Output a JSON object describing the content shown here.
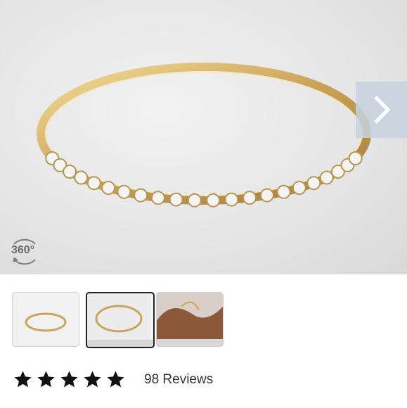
{
  "gallery": {
    "next_icon": "chevron-right-icon",
    "spin_badge": {
      "label": "360°",
      "icon": "rotate-360-icon"
    },
    "thumbnails": [
      {
        "id": "thumb-front-view",
        "selected": false
      },
      {
        "id": "thumb-angle-view",
        "selected": true
      },
      {
        "id": "thumb-on-hand",
        "selected": false
      }
    ]
  },
  "rating": {
    "stars": 5,
    "count_label": "98 Reviews"
  },
  "colors": {
    "gold": "#d9b86a",
    "accent_arrow_bg": "#c8d2de"
  }
}
